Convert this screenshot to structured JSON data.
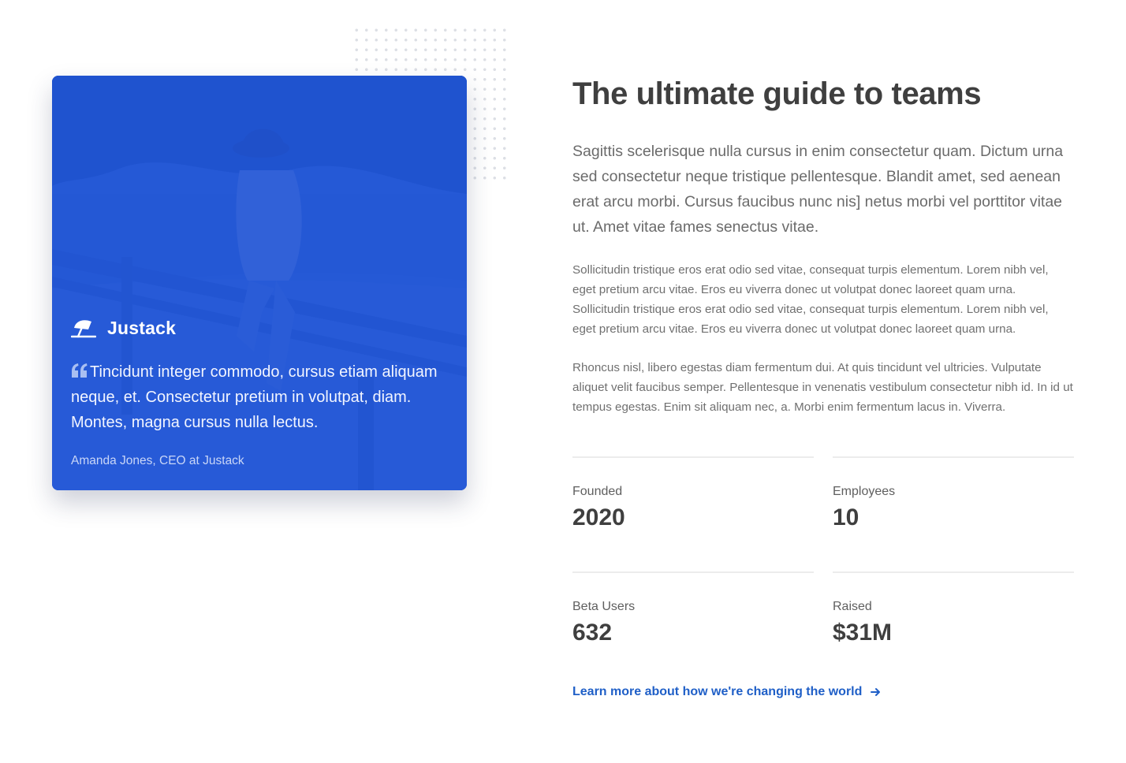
{
  "card": {
    "brand_name": "Justack",
    "brand_icon": "umbrella-icon",
    "quote_icon": "quote-icon",
    "quote": "Tincidunt integer commodo, cursus etiam aliquam neque, et. Consectetur pretium in volutpat, diam. Montes, magna cursus nulla lectus.",
    "author": "Amanda Jones, CEO at Justack",
    "tint_color": "#2054d6"
  },
  "content": {
    "title": "The ultimate guide to teams",
    "lead": "Sagittis scelerisque nulla cursus in enim consectetur quam. Dictum urna sed consectetur neque tristique pellentesque. Blandit amet, sed aenean erat arcu morbi. Cursus faucibus nunc nis] netus morbi vel porttitor vitae ut. Amet vitae fames senectus vitae.",
    "paragraph_1": "Sollicitudin tristique eros erat odio sed vitae, consequat turpis elementum. Lorem nibh vel, eget pretium arcu vitae. Eros eu viverra donec ut volutpat donec laoreet quam urna. Sollicitudin tristique eros erat odio sed vitae, consequat turpis elementum. Lorem nibh vel, eget pretium arcu vitae. Eros eu viverra donec ut volutpat donec laoreet quam urna.",
    "paragraph_2": "Rhoncus nisl, libero egestas diam fermentum dui. At quis tincidunt vel ultricies. Vulputate aliquet velit faucibus semper. Pellentesque in venenatis vestibulum consectetur nibh id. In id ut tempus egestas. Enim sit aliquam nec, a. Morbi enim fermentum lacus in. Viverra."
  },
  "stats": [
    {
      "label": "Founded",
      "value": "2020"
    },
    {
      "label": "Employees",
      "value": "10"
    },
    {
      "label": "Beta Users",
      "value": "632"
    },
    {
      "label": "Raised",
      "value": "$31M"
    }
  ],
  "learn_more": {
    "label": "Learn more about how we're changing the world",
    "icon": "arrow-right-icon",
    "color": "#1f5fc7"
  }
}
